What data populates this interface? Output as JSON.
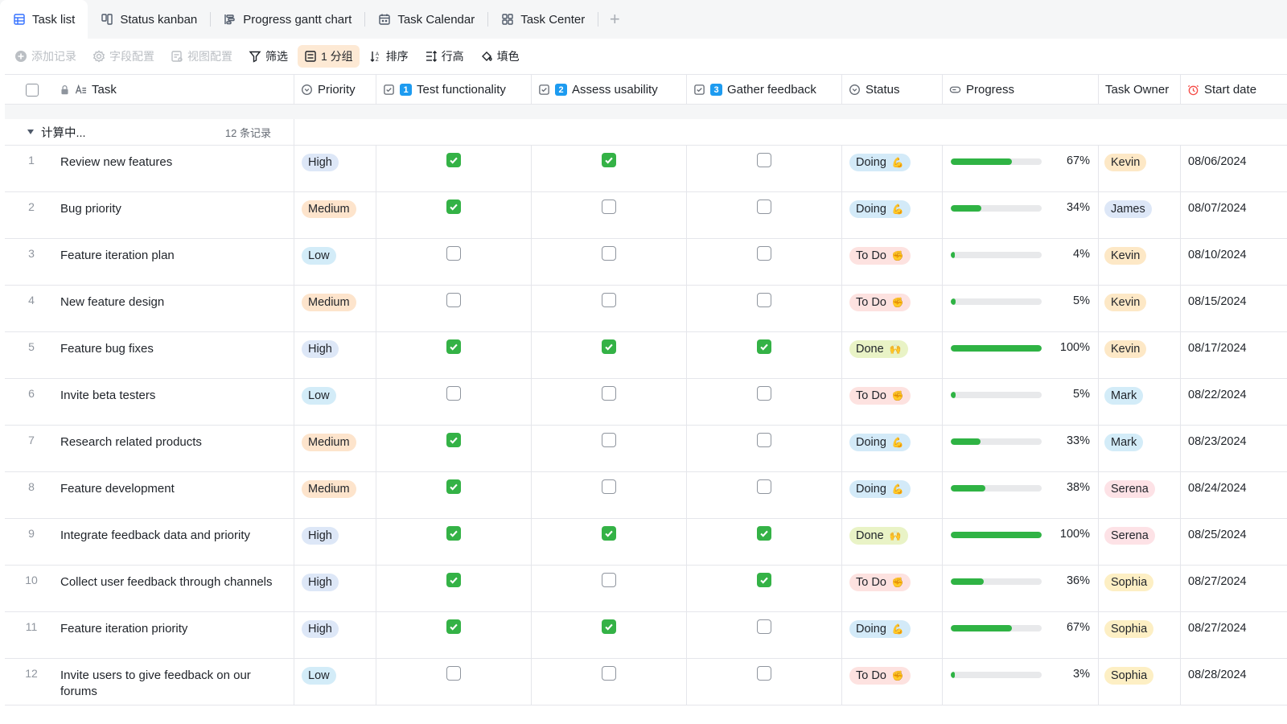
{
  "tabs": [
    {
      "label": "Task list",
      "icon": "table-icon",
      "active": true
    },
    {
      "label": "Status kanban",
      "icon": "kanban-icon",
      "active": false
    },
    {
      "label": "Progress gantt chart",
      "icon": "gantt-icon",
      "active": false
    },
    {
      "label": "Task Calendar",
      "icon": "calendar-icon",
      "active": false
    },
    {
      "label": "Task Center",
      "icon": "dashboard-icon",
      "active": false
    }
  ],
  "add_tab_label": "+",
  "toolbar": {
    "add_record": "添加记录",
    "field_config": "字段配置",
    "view_config": "视图配置",
    "filter": "筛选",
    "group": "1 分组",
    "sort": "排序",
    "row_height": "行高",
    "fill_color": "填色"
  },
  "columns": {
    "task": "Task",
    "priority": "Priority",
    "test": "Test functionality",
    "test_num": "1",
    "assess": "Assess usability",
    "assess_num": "2",
    "gather": "Gather feedback",
    "gather_num": "3",
    "status": "Status",
    "progress": "Progress",
    "owner": "Task Owner",
    "start": "Start date"
  },
  "group": {
    "label": "计算中...",
    "count": "12 条记录"
  },
  "colors": {
    "High": "#dde7f7",
    "Medium": "#fde4cc",
    "Low": "#d3ecf8",
    "Doing": "#d3eaf8",
    "To Do": "#fde2e0",
    "Done": "#e9f3c6",
    "Kevin": "#fde8c6",
    "James": "#dde7f7",
    "Mark": "#d3ecf8",
    "Serena": "#fde2e6",
    "Sophia": "#fdefc4"
  },
  "status_emoji": {
    "Doing": "💪",
    "To Do": "✊",
    "Done": "🙌"
  },
  "rows": [
    {
      "num": "1",
      "task": "Review new features",
      "priority": "High",
      "test": true,
      "assess": true,
      "gather": false,
      "status": "Doing",
      "progress": 0.67,
      "progress_label": "67%",
      "owner": "Kevin",
      "start": "08/06/2024"
    },
    {
      "num": "2",
      "task": "Bug priority",
      "priority": "Medium",
      "test": true,
      "assess": false,
      "gather": false,
      "status": "Doing",
      "progress": 0.34,
      "progress_label": "34%",
      "owner": "James",
      "start": "08/07/2024"
    },
    {
      "num": "3",
      "task": "Feature iteration plan",
      "priority": "Low",
      "test": false,
      "assess": false,
      "gather": false,
      "status": "To Do",
      "progress": 0.04,
      "progress_label": "4%",
      "owner": "Kevin",
      "start": "08/10/2024"
    },
    {
      "num": "4",
      "task": "New feature design",
      "priority": "Medium",
      "test": false,
      "assess": false,
      "gather": false,
      "status": "To Do",
      "progress": 0.05,
      "progress_label": "5%",
      "owner": "Kevin",
      "start": "08/15/2024"
    },
    {
      "num": "5",
      "task": "Feature bug fixes",
      "priority": "High",
      "test": true,
      "assess": true,
      "gather": true,
      "status": "Done",
      "progress": 1.0,
      "progress_label": "100%",
      "owner": "Kevin",
      "start": "08/17/2024"
    },
    {
      "num": "6",
      "task": "Invite beta testers",
      "priority": "Low",
      "test": false,
      "assess": false,
      "gather": false,
      "status": "To Do",
      "progress": 0.05,
      "progress_label": "5%",
      "owner": "Mark",
      "start": "08/22/2024"
    },
    {
      "num": "7",
      "task": "Research related products",
      "priority": "Medium",
      "test": true,
      "assess": false,
      "gather": false,
      "status": "Doing",
      "progress": 0.33,
      "progress_label": "33%",
      "owner": "Mark",
      "start": "08/23/2024"
    },
    {
      "num": "8",
      "task": "Feature development",
      "priority": "Medium",
      "test": true,
      "assess": false,
      "gather": false,
      "status": "Doing",
      "progress": 0.38,
      "progress_label": "38%",
      "owner": "Serena",
      "start": "08/24/2024"
    },
    {
      "num": "9",
      "task": "Integrate feedback data and priority",
      "priority": "High",
      "test": true,
      "assess": true,
      "gather": true,
      "status": "Done",
      "progress": 1.0,
      "progress_label": "100%",
      "owner": "Serena",
      "start": "08/25/2024"
    },
    {
      "num": "10",
      "task": "Collect user feedback through channels",
      "priority": "High",
      "test": true,
      "assess": false,
      "gather": true,
      "status": "To Do",
      "progress": 0.36,
      "progress_label": "36%",
      "owner": "Sophia",
      "start": "08/27/2024"
    },
    {
      "num": "11",
      "task": "Feature iteration priority",
      "priority": "High",
      "test": true,
      "assess": true,
      "gather": false,
      "status": "Doing",
      "progress": 0.67,
      "progress_label": "67%",
      "owner": "Sophia",
      "start": "08/27/2024"
    },
    {
      "num": "12",
      "task": "Invite users to give feedback on our forums",
      "priority": "Low",
      "test": false,
      "assess": false,
      "gather": false,
      "status": "To Do",
      "progress": 0.03,
      "progress_label": "3%",
      "owner": "Sophia",
      "start": "08/28/2024"
    }
  ]
}
